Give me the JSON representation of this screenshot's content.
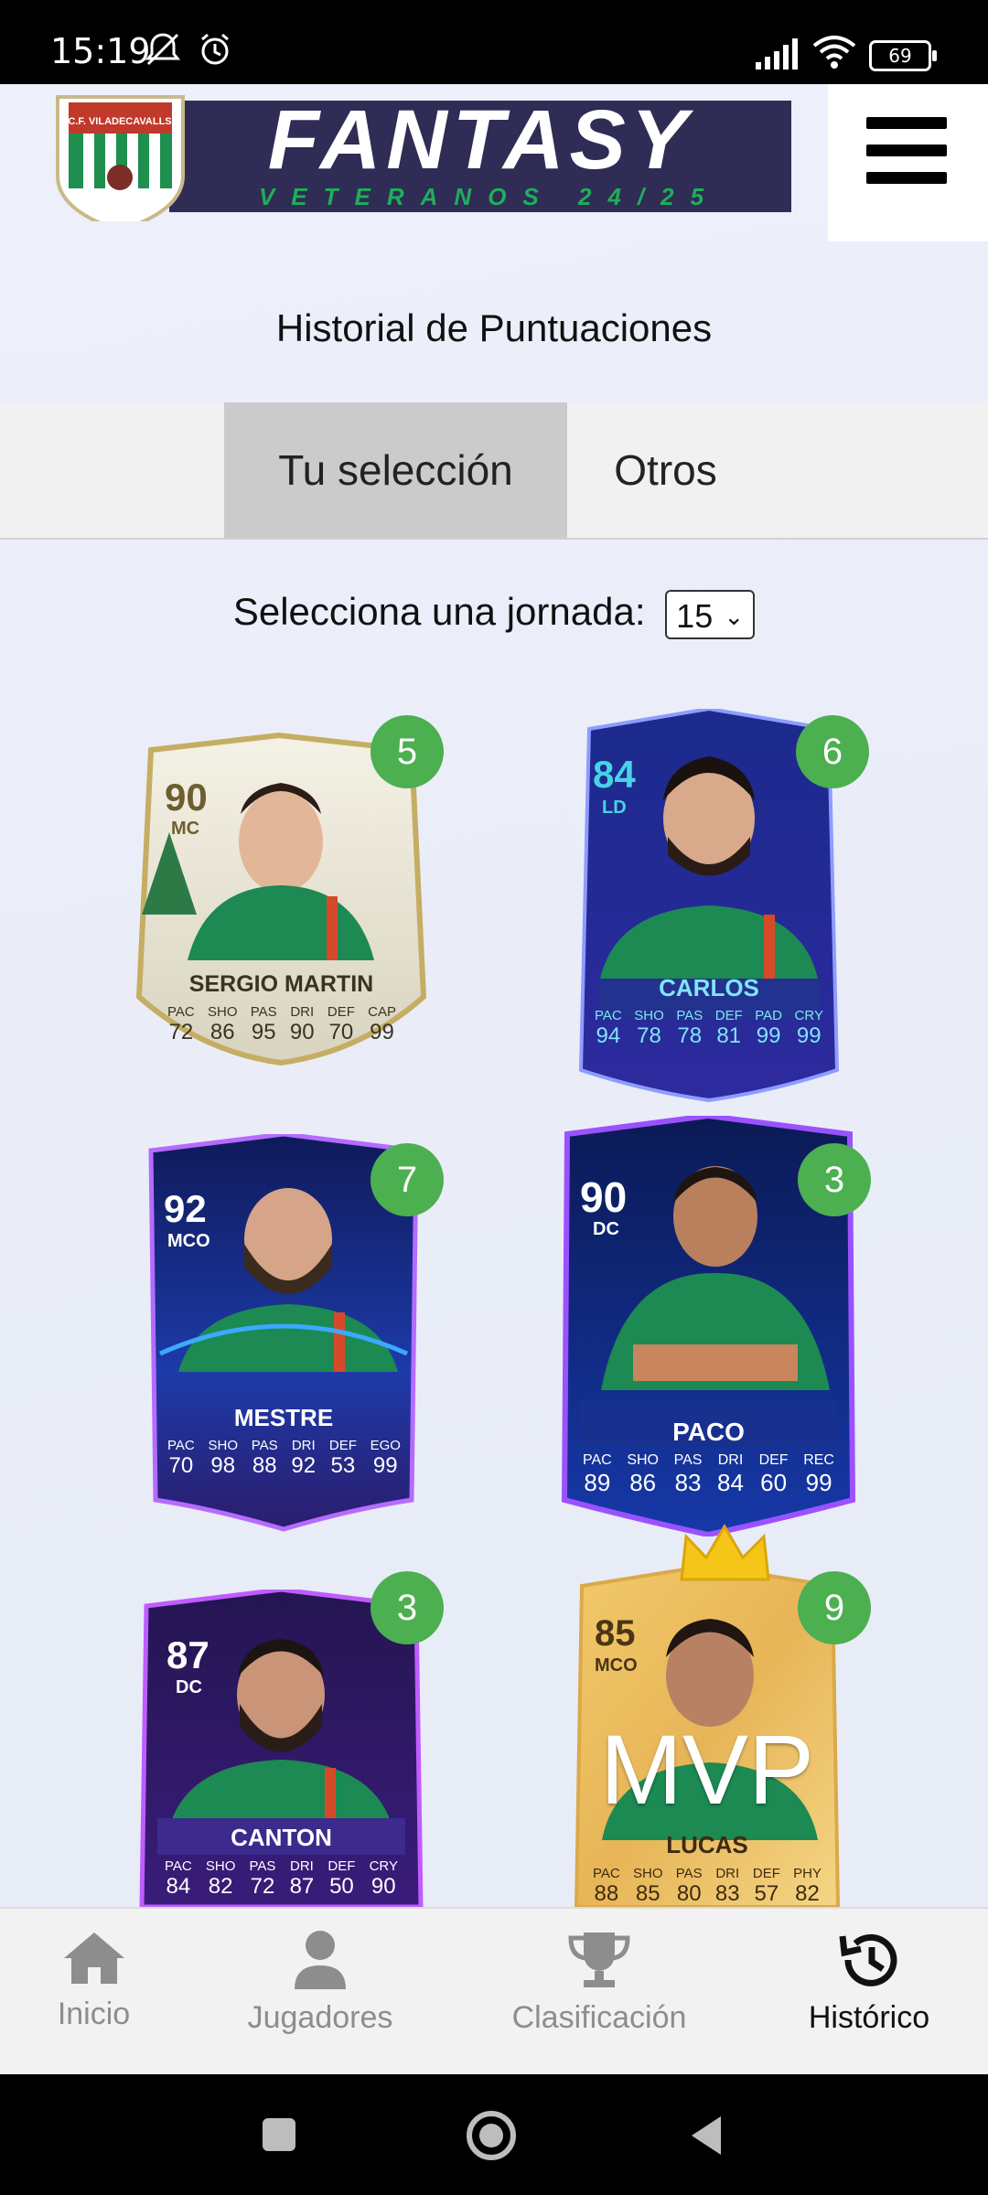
{
  "status": {
    "time": "15:19",
    "battery": "69"
  },
  "header": {
    "logo_title": "FANTASY",
    "logo_subtitle": "VETERANOS 24/25",
    "logo_badge": "C.F. VILADECAVALLS"
  },
  "page": {
    "title": "Historial de Puntuaciones"
  },
  "tabs": [
    {
      "label": "Tu selección"
    },
    {
      "label": "Otros"
    }
  ],
  "selector": {
    "label": "Selecciona una jornada:",
    "value": "15"
  },
  "cards": [
    {
      "name": "SERGIO MARTIN",
      "rating": "90",
      "position": "MC",
      "score": "5",
      "stats": [
        {
          "k": "PAC",
          "v": "72"
        },
        {
          "k": "SHO",
          "v": "86"
        },
        {
          "k": "PAS",
          "v": "95"
        },
        {
          "k": "DRI",
          "v": "90"
        },
        {
          "k": "DEF",
          "v": "70"
        },
        {
          "k": "CAP",
          "v": "99"
        }
      ]
    },
    {
      "name": "CARLOS",
      "rating": "84",
      "position": "LD",
      "score": "6",
      "stats": [
        {
          "k": "PAC",
          "v": "94"
        },
        {
          "k": "SHO",
          "v": "78"
        },
        {
          "k": "PAS",
          "v": "78"
        },
        {
          "k": "DEF",
          "v": "81"
        },
        {
          "k": "PAD",
          "v": "99"
        },
        {
          "k": "CRY",
          "v": "99"
        }
      ]
    },
    {
      "name": "MESTRE",
      "rating": "92",
      "position": "MCO",
      "score": "7",
      "stats": [
        {
          "k": "PAC",
          "v": "70"
        },
        {
          "k": "SHO",
          "v": "98"
        },
        {
          "k": "PAS",
          "v": "88"
        },
        {
          "k": "DRI",
          "v": "92"
        },
        {
          "k": "DEF",
          "v": "53"
        },
        {
          "k": "EGO",
          "v": "99"
        }
      ]
    },
    {
      "name": "PACO",
      "rating": "90",
      "position": "DC",
      "score": "3",
      "stats": [
        {
          "k": "PAC",
          "v": "89"
        },
        {
          "k": "SHO",
          "v": "86"
        },
        {
          "k": "PAS",
          "v": "83"
        },
        {
          "k": "DRI",
          "v": "84"
        },
        {
          "k": "DEF",
          "v": "60"
        },
        {
          "k": "REC",
          "v": "99"
        }
      ]
    },
    {
      "name": "CANTON",
      "rating": "87",
      "position": "DC",
      "score": "3",
      "stats": [
        {
          "k": "PAC",
          "v": "84"
        },
        {
          "k": "SHO",
          "v": "82"
        },
        {
          "k": "PAS",
          "v": "72"
        },
        {
          "k": "DRI",
          "v": "87"
        },
        {
          "k": "DEF",
          "v": "50"
        },
        {
          "k": "CRY",
          "v": "90"
        }
      ]
    },
    {
      "name": "LUCAS",
      "rating": "85",
      "position": "MCO",
      "score": "9",
      "overlay": "MVP",
      "stats": [
        {
          "k": "PAC",
          "v": "88"
        },
        {
          "k": "SHO",
          "v": "85"
        },
        {
          "k": "PAS",
          "v": "80"
        },
        {
          "k": "DRI",
          "v": "83"
        },
        {
          "k": "DEF",
          "v": "57"
        },
        {
          "k": "PHY",
          "v": "82"
        }
      ]
    }
  ],
  "nav": [
    {
      "label": "Inicio"
    },
    {
      "label": "Jugadores"
    },
    {
      "label": "Clasificación"
    },
    {
      "label": "Histórico"
    }
  ],
  "colors": {
    "score_badge": "#4caf50",
    "tab_active": "#cbcbcb",
    "jersey": "#1c8a52"
  }
}
